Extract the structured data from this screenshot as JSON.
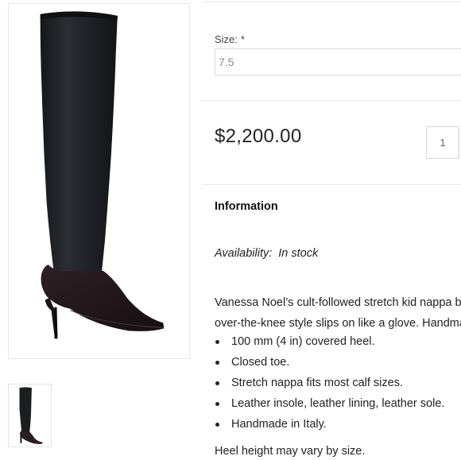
{
  "product": {
    "image_alt_icon": "over-the-knee-boot-image",
    "thumbnail_icon": "boot-thumbnail-image"
  },
  "size": {
    "label": "Size:",
    "required_mark": "*",
    "value": "7.5"
  },
  "price": "$2,200.00",
  "quantity": "1",
  "information": {
    "heading": "Information",
    "availability_label": "Availability:",
    "availability_value": "In stock",
    "description_lines": [
      "Vanessa Noel’s cult-followed stretch kid nappa b",
      "over-the-knee style slips on like a glove. Handma"
    ],
    "features": [
      "100 mm (4 in) covered heel.",
      "Closed toe.",
      "Stretch nappa fits most calf sizes.",
      "Leather insole, leather lining, leather sole.",
      "Handmade in Italy."
    ],
    "note": "Heel height may vary by size."
  },
  "colors": {
    "boot_leather": "#1c1f22",
    "boot_foot": "#2a1e22",
    "border": "#e6e6e6"
  }
}
